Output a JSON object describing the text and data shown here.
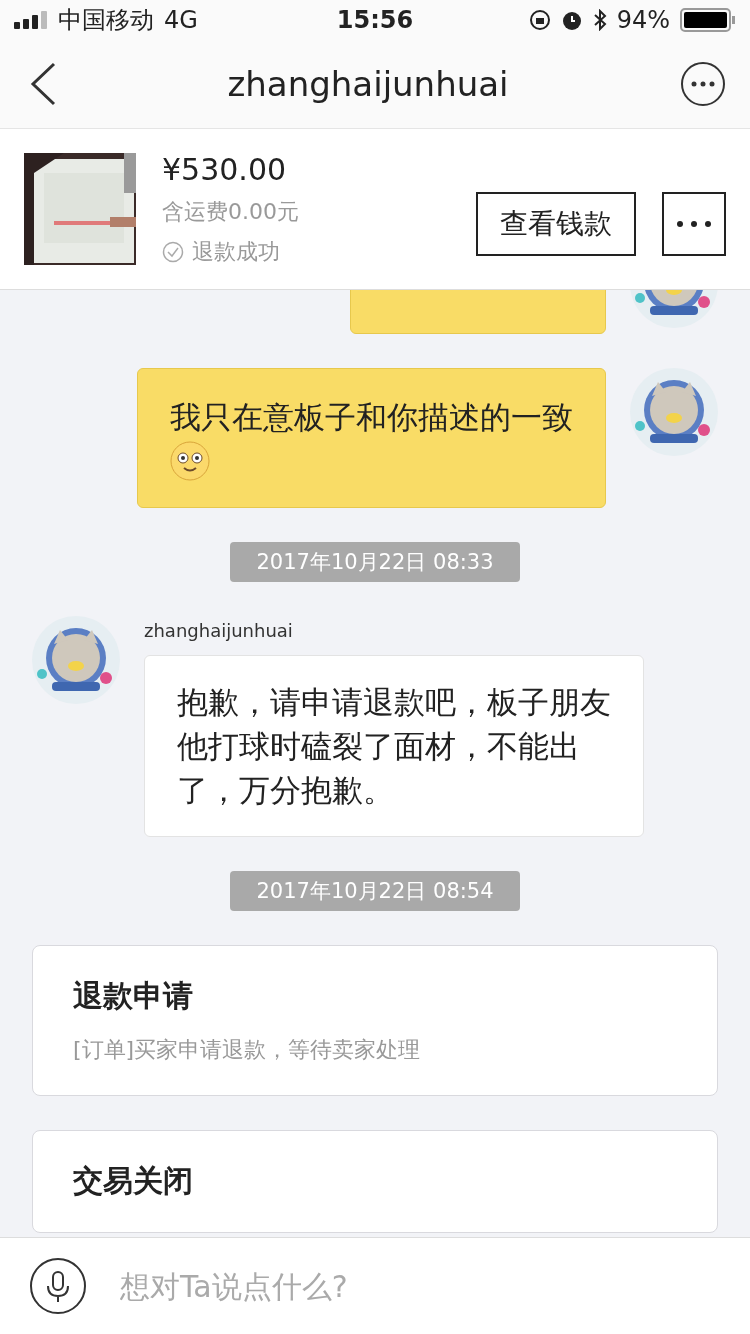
{
  "status_bar": {
    "carrier": "中国移动",
    "network": "4G",
    "time": "15:56",
    "battery": "94%"
  },
  "nav": {
    "title": "zhanghaijunhuai"
  },
  "order": {
    "price": "¥530.00",
    "shipping": "含运费0.00元",
    "status": "退款成功",
    "button": "查看钱款"
  },
  "messages": [
    {
      "kind": "outgoing"
    },
    {
      "kind": "outgoing",
      "text": "我只在意板子和你描述的一致",
      "emoji": true
    },
    {
      "kind": "time",
      "text": "2017年10月22日 08:33"
    },
    {
      "kind": "incoming",
      "sender": "zhanghaijunhuai",
      "text": "抱歉，请申请退款吧，板子朋友他打球时磕裂了面材，不能出了，万分抱歉。"
    },
    {
      "kind": "time",
      "text": "2017年10月22日 08:54"
    },
    {
      "kind": "card",
      "title": "退款申请",
      "text": "[订单]买家申请退款，等待卖家处理"
    },
    {
      "kind": "card",
      "title": "交易关闭"
    }
  ],
  "input": {
    "placeholder": "想对Ta说点什么?"
  }
}
